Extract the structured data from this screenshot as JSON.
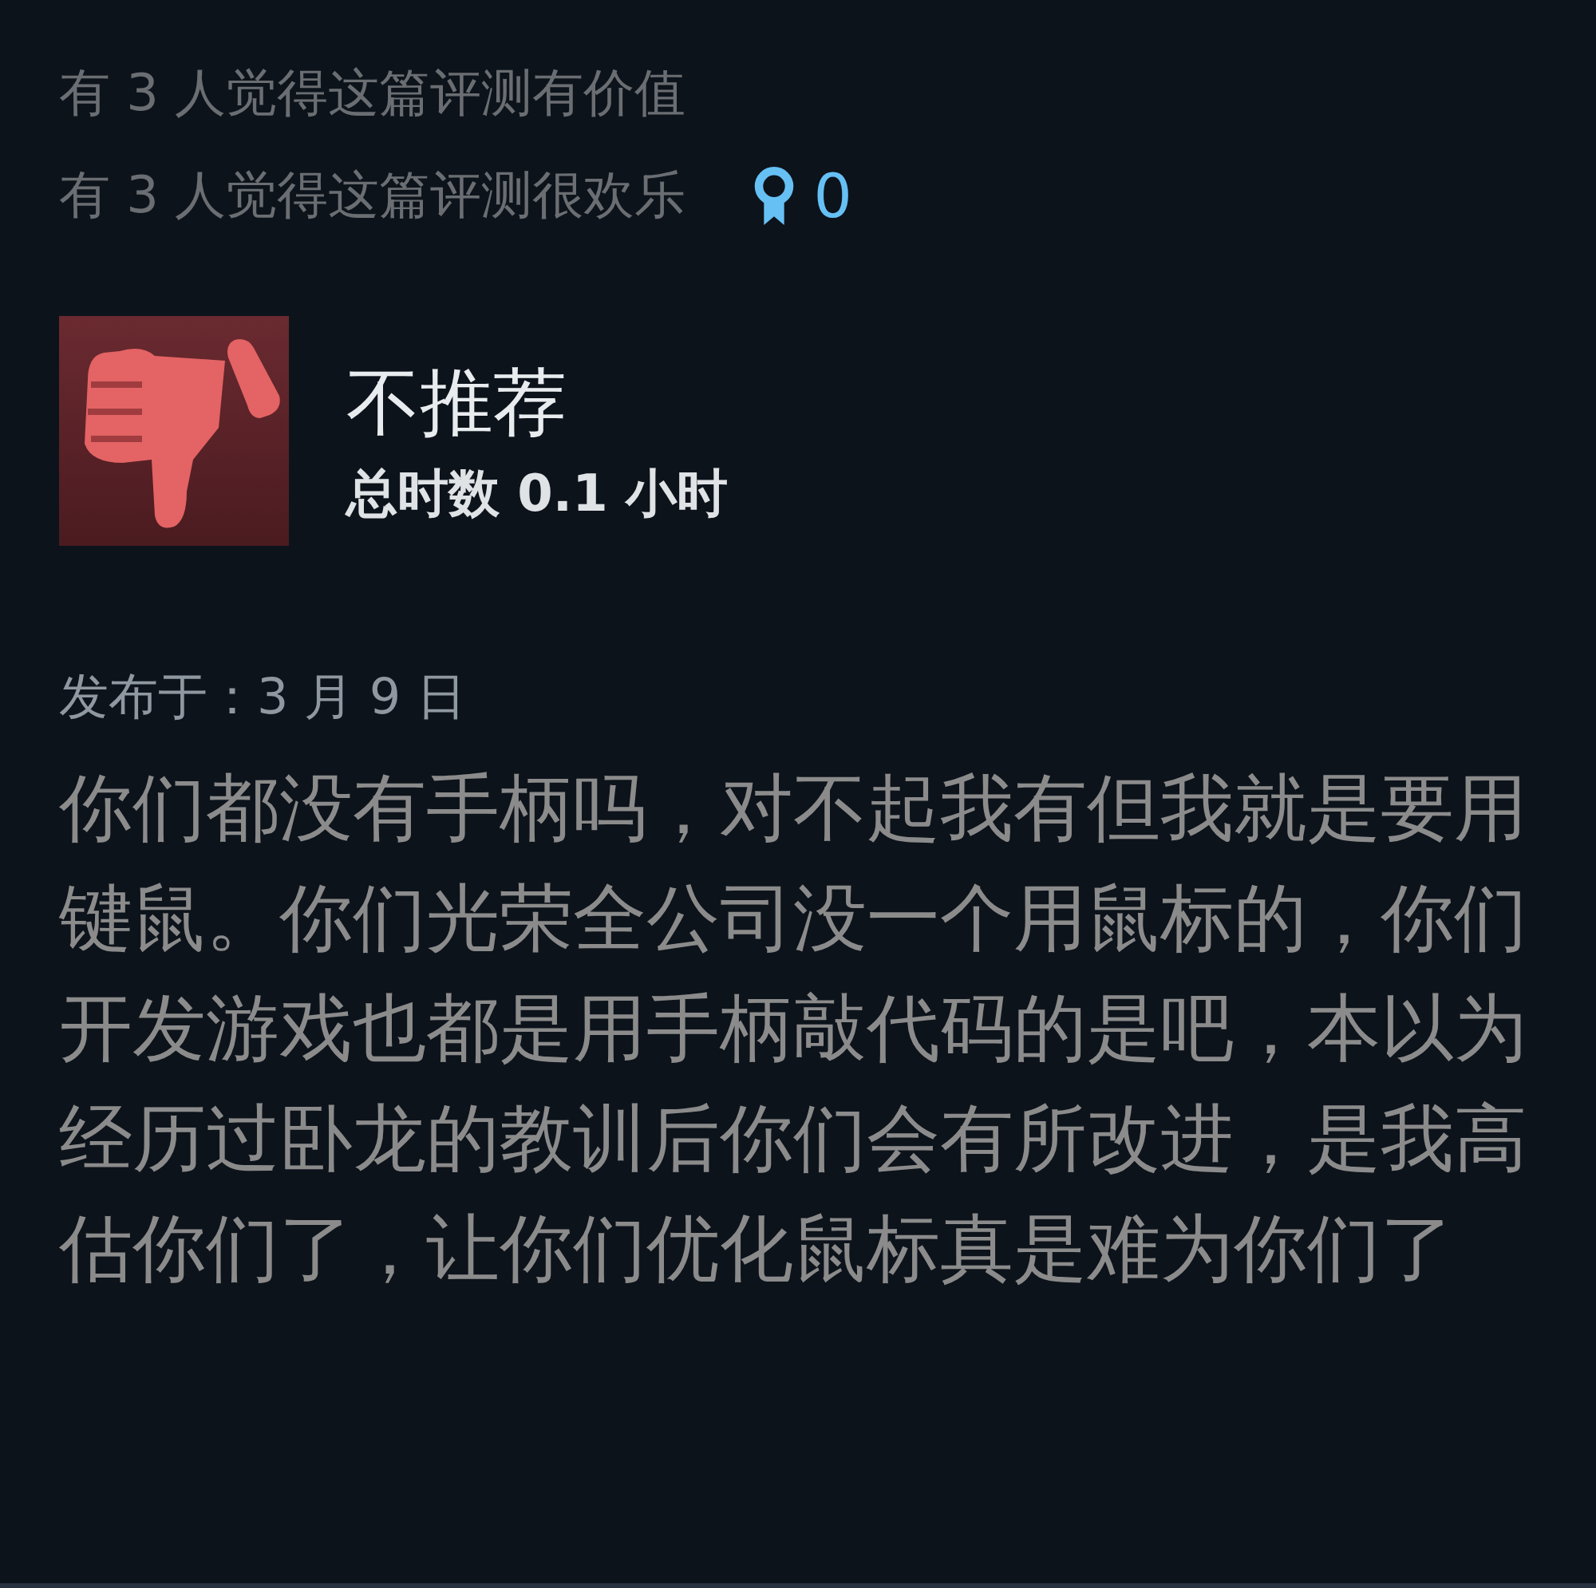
{
  "votes": [
    {
      "text": "有 3 人觉得这篇评测有价值"
    },
    {
      "text": "有 3 人觉得这篇评测很欢乐",
      "award_count": "0"
    }
  ],
  "review": {
    "recommended": false,
    "verdict": "不推荐",
    "playtime": "总时数 0.1 小时",
    "posted": "发布于：3 月 9 日",
    "body": "你们都没有手柄吗，对不起我有但我就是要用键鼠。你们光荣全公司没一个用鼠标的，你们开发游戏也都是用手柄敲代码的是吧，本以为经历过卧龙的教训后你们会有所改进，是我高估你们了，让你们优化鼠标真是难为你们了"
  }
}
